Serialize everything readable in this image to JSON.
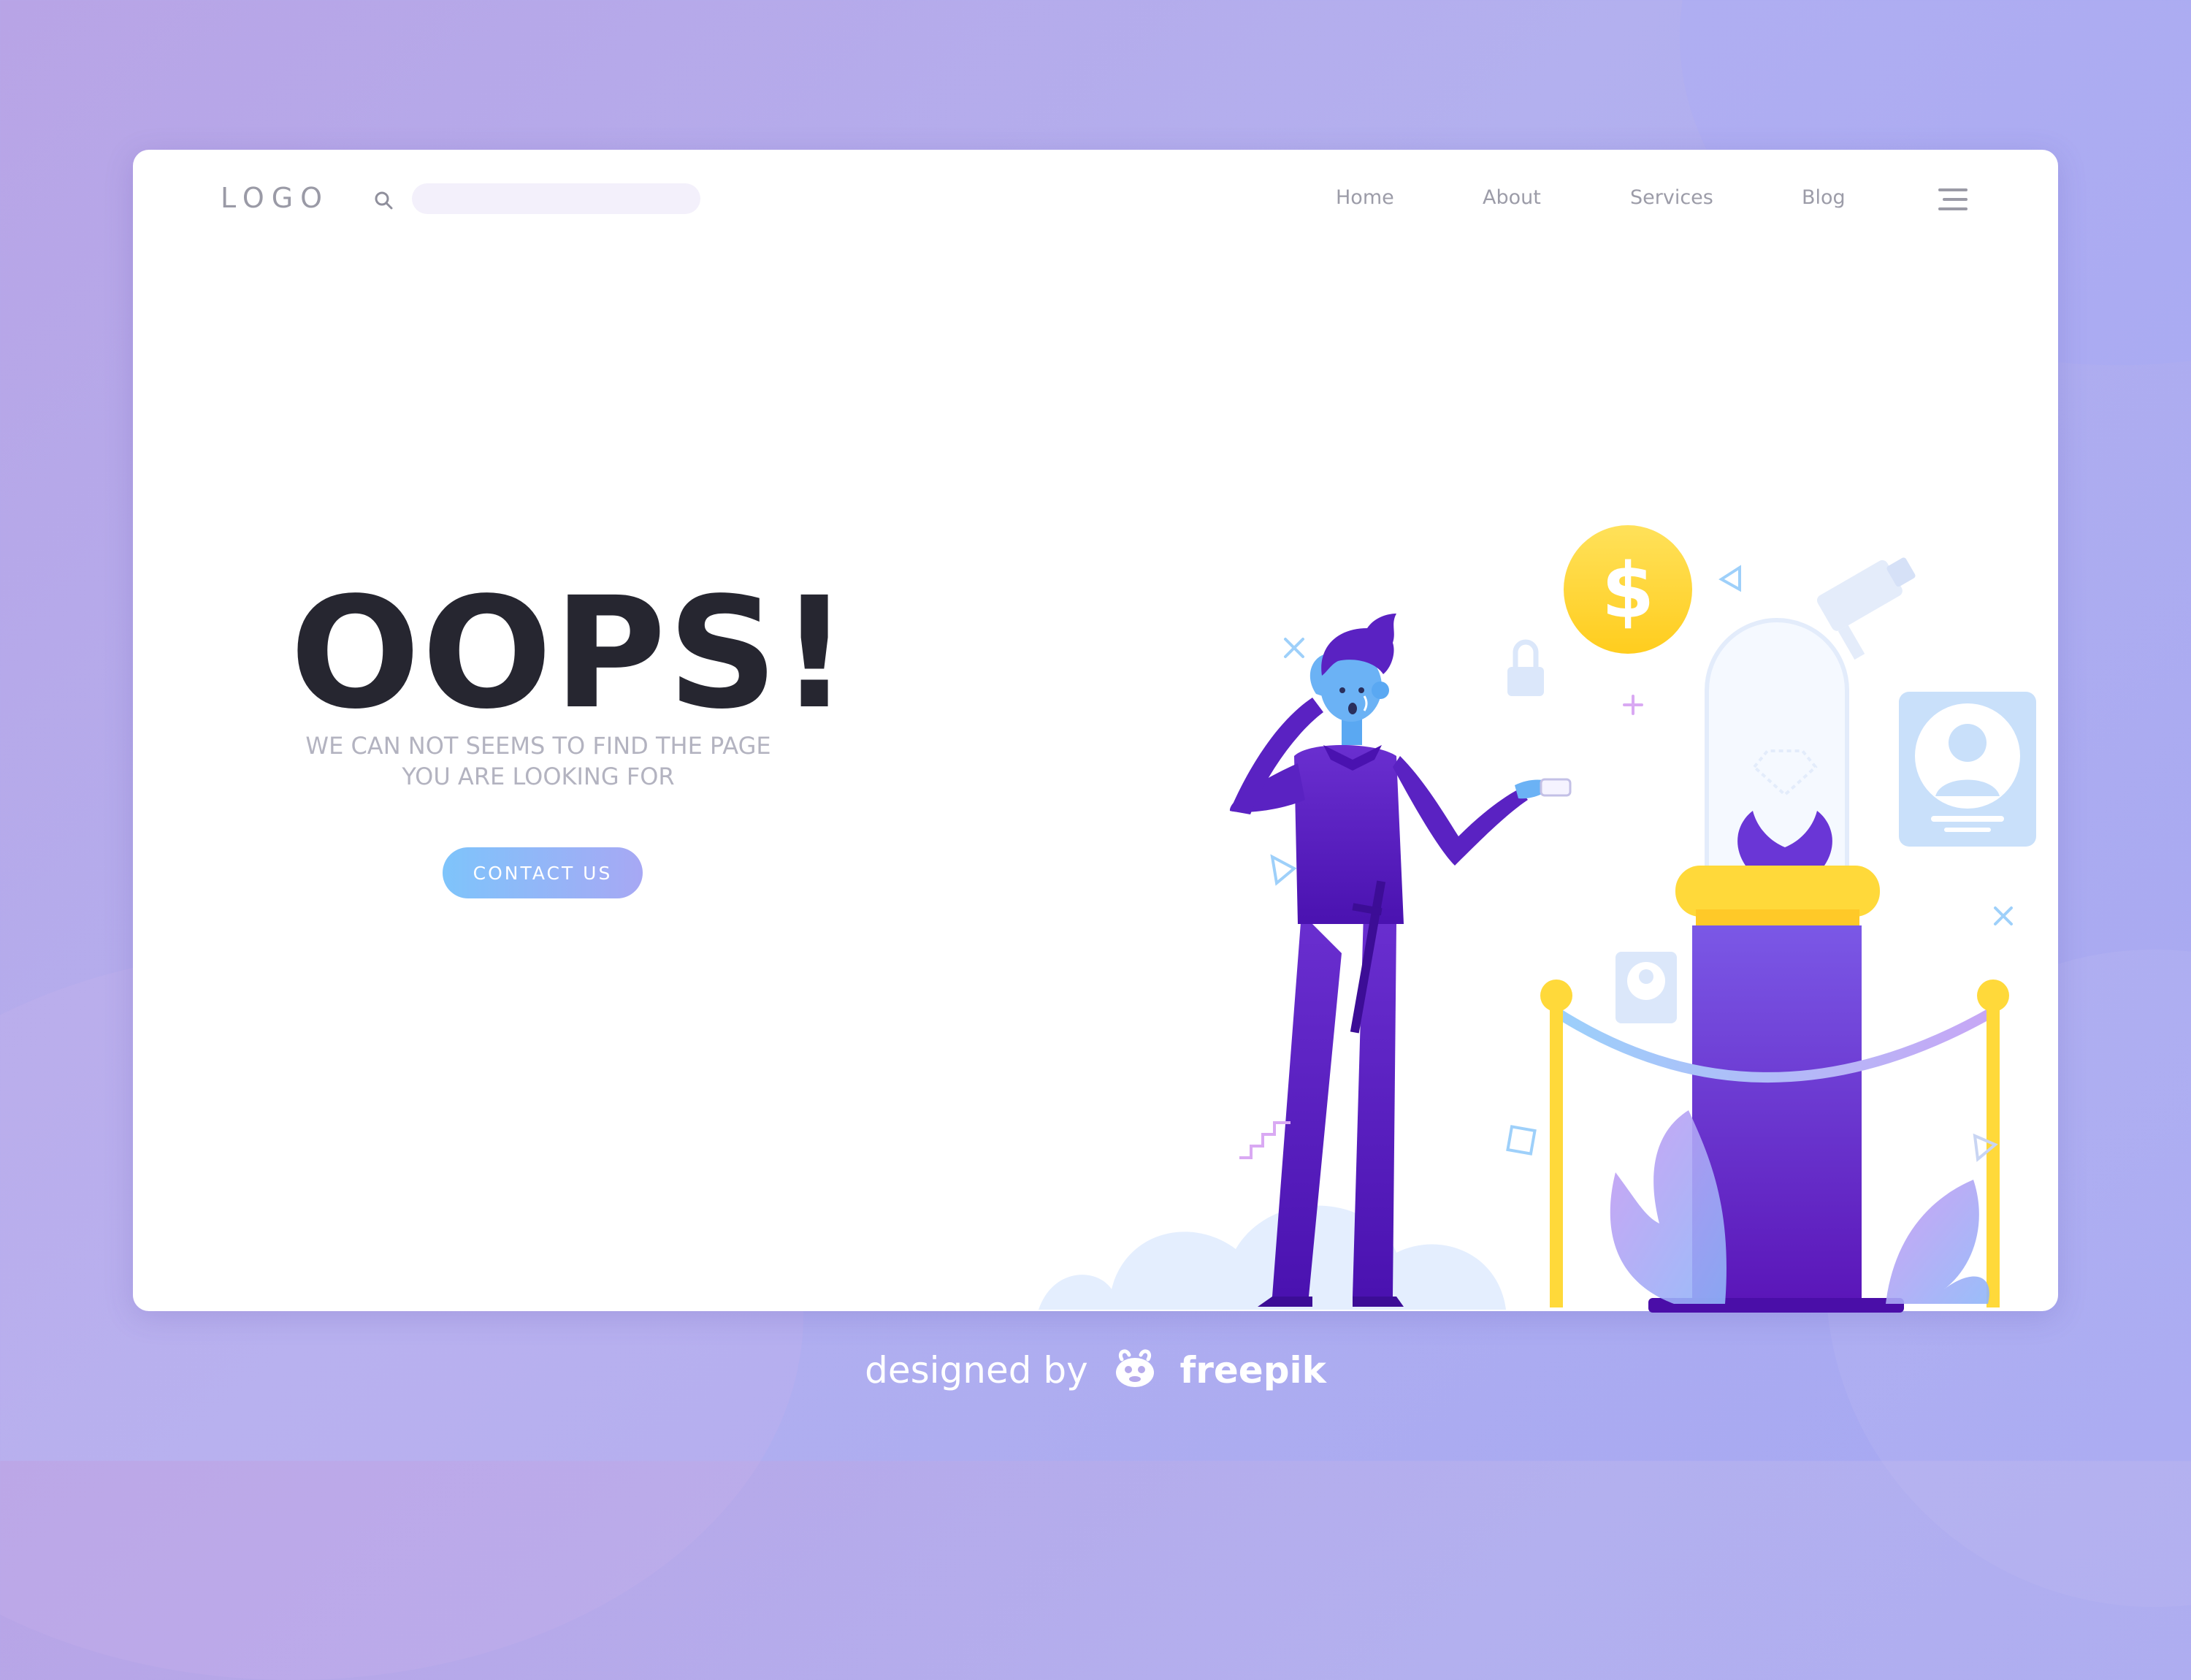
{
  "header": {
    "logo_text": "LOGO",
    "search": {
      "placeholder": ""
    },
    "nav": [
      {
        "label": "Home"
      },
      {
        "label": "About"
      },
      {
        "label": "Services"
      },
      {
        "label": "Blog"
      }
    ]
  },
  "hero": {
    "title": "OOPS!",
    "subtitle_line1": "WE CAN NOT SEEMS TO FIND THE PAGE",
    "subtitle_line2": "YOU ARE LOOKING FOR",
    "cta_label": "CONTACT US"
  },
  "illustration": {
    "coin_symbol": "$",
    "icons": [
      "dollar-coin-icon",
      "padlock-icon",
      "security-camera-icon",
      "id-card-icon",
      "diamond-icon"
    ]
  },
  "credit": {
    "prefix": "designed by",
    "brand": "freepik"
  },
  "colors": {
    "background_start": "#b8a4e6",
    "background_end": "#a6a8f2",
    "card": "#ffffff",
    "title": "#262630",
    "subtitle": "#b3b3c0",
    "nav_text": "#9c9ca8",
    "button_start": "#7ec4fb",
    "button_end": "#a7a8f4",
    "character_purple": "#5a1fbf",
    "coin_yellow": "#ffd634"
  }
}
